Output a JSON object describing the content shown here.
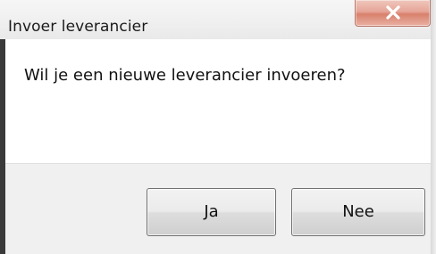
{
  "window": {
    "title": "Invoer leverancier"
  },
  "dialog": {
    "message": "Wil je een nieuwe leverancier invoeren?",
    "yes_label": "Ja",
    "no_label": "Nee"
  },
  "icons": {
    "close": "close-icon"
  }
}
